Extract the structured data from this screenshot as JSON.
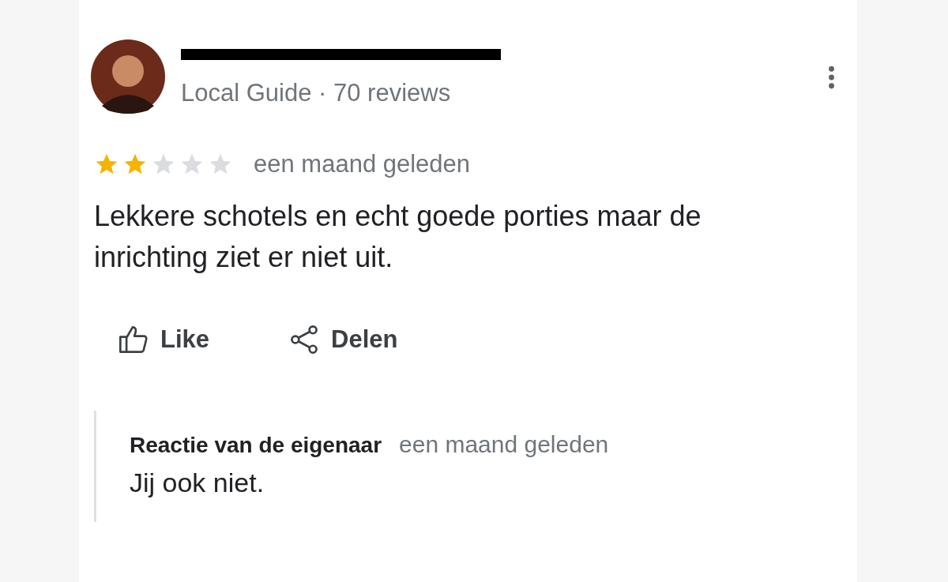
{
  "review": {
    "author_redacted": true,
    "badge": "Local Guide · 70 reviews",
    "stars": 2,
    "time": "een maand geleden",
    "text": "Lekkere schotels en echt goede porties maar de inrichting ziet er niet uit."
  },
  "actions": [
    {
      "kind": "like",
      "label": "Like"
    },
    {
      "kind": "share",
      "label": "Delen"
    }
  ],
  "owner_reply": {
    "title": "Reactie van de eigenaar",
    "time": "een maand geleden",
    "text": "Jij ook niet."
  }
}
